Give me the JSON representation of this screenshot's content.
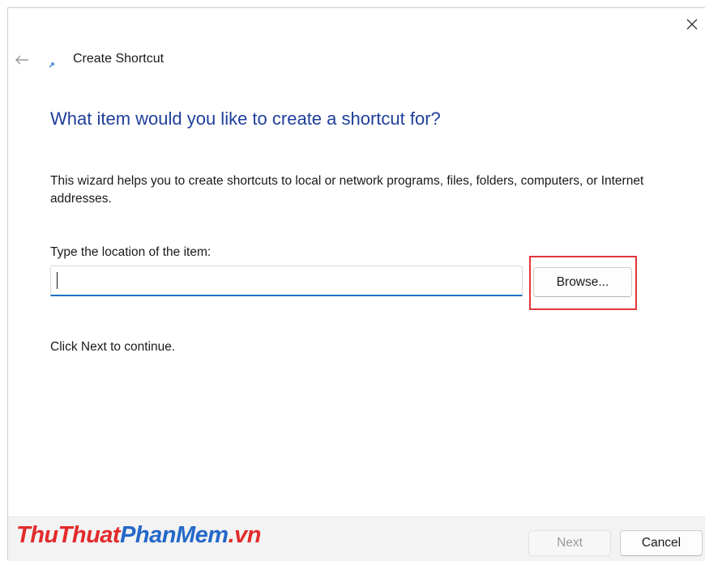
{
  "window": {
    "title": "Create Shortcut",
    "close_icon": "close-icon",
    "back_icon": "back-arrow-icon",
    "shortcut_icon": "shortcut-arrow-icon"
  },
  "content": {
    "heading": "What item would you like to create a shortcut for?",
    "description": "This wizard helps you to create shortcuts to local or network programs, files, folders, computers, or Internet addresses.",
    "location_label": "Type the location of the item:",
    "location_value": "",
    "browse_label": "Browse...",
    "status": "Click Next to continue."
  },
  "footer": {
    "next_label": "Next",
    "cancel_label": "Cancel"
  },
  "watermark": {
    "part1": "ThuThuat",
    "part2": "PhanMem",
    "part3": ".vn"
  },
  "colors": {
    "heading": "#1f3f9a",
    "accent": "#1e6fc4",
    "highlight": "#e0373a",
    "footer_bg": "#f3f3f3"
  }
}
